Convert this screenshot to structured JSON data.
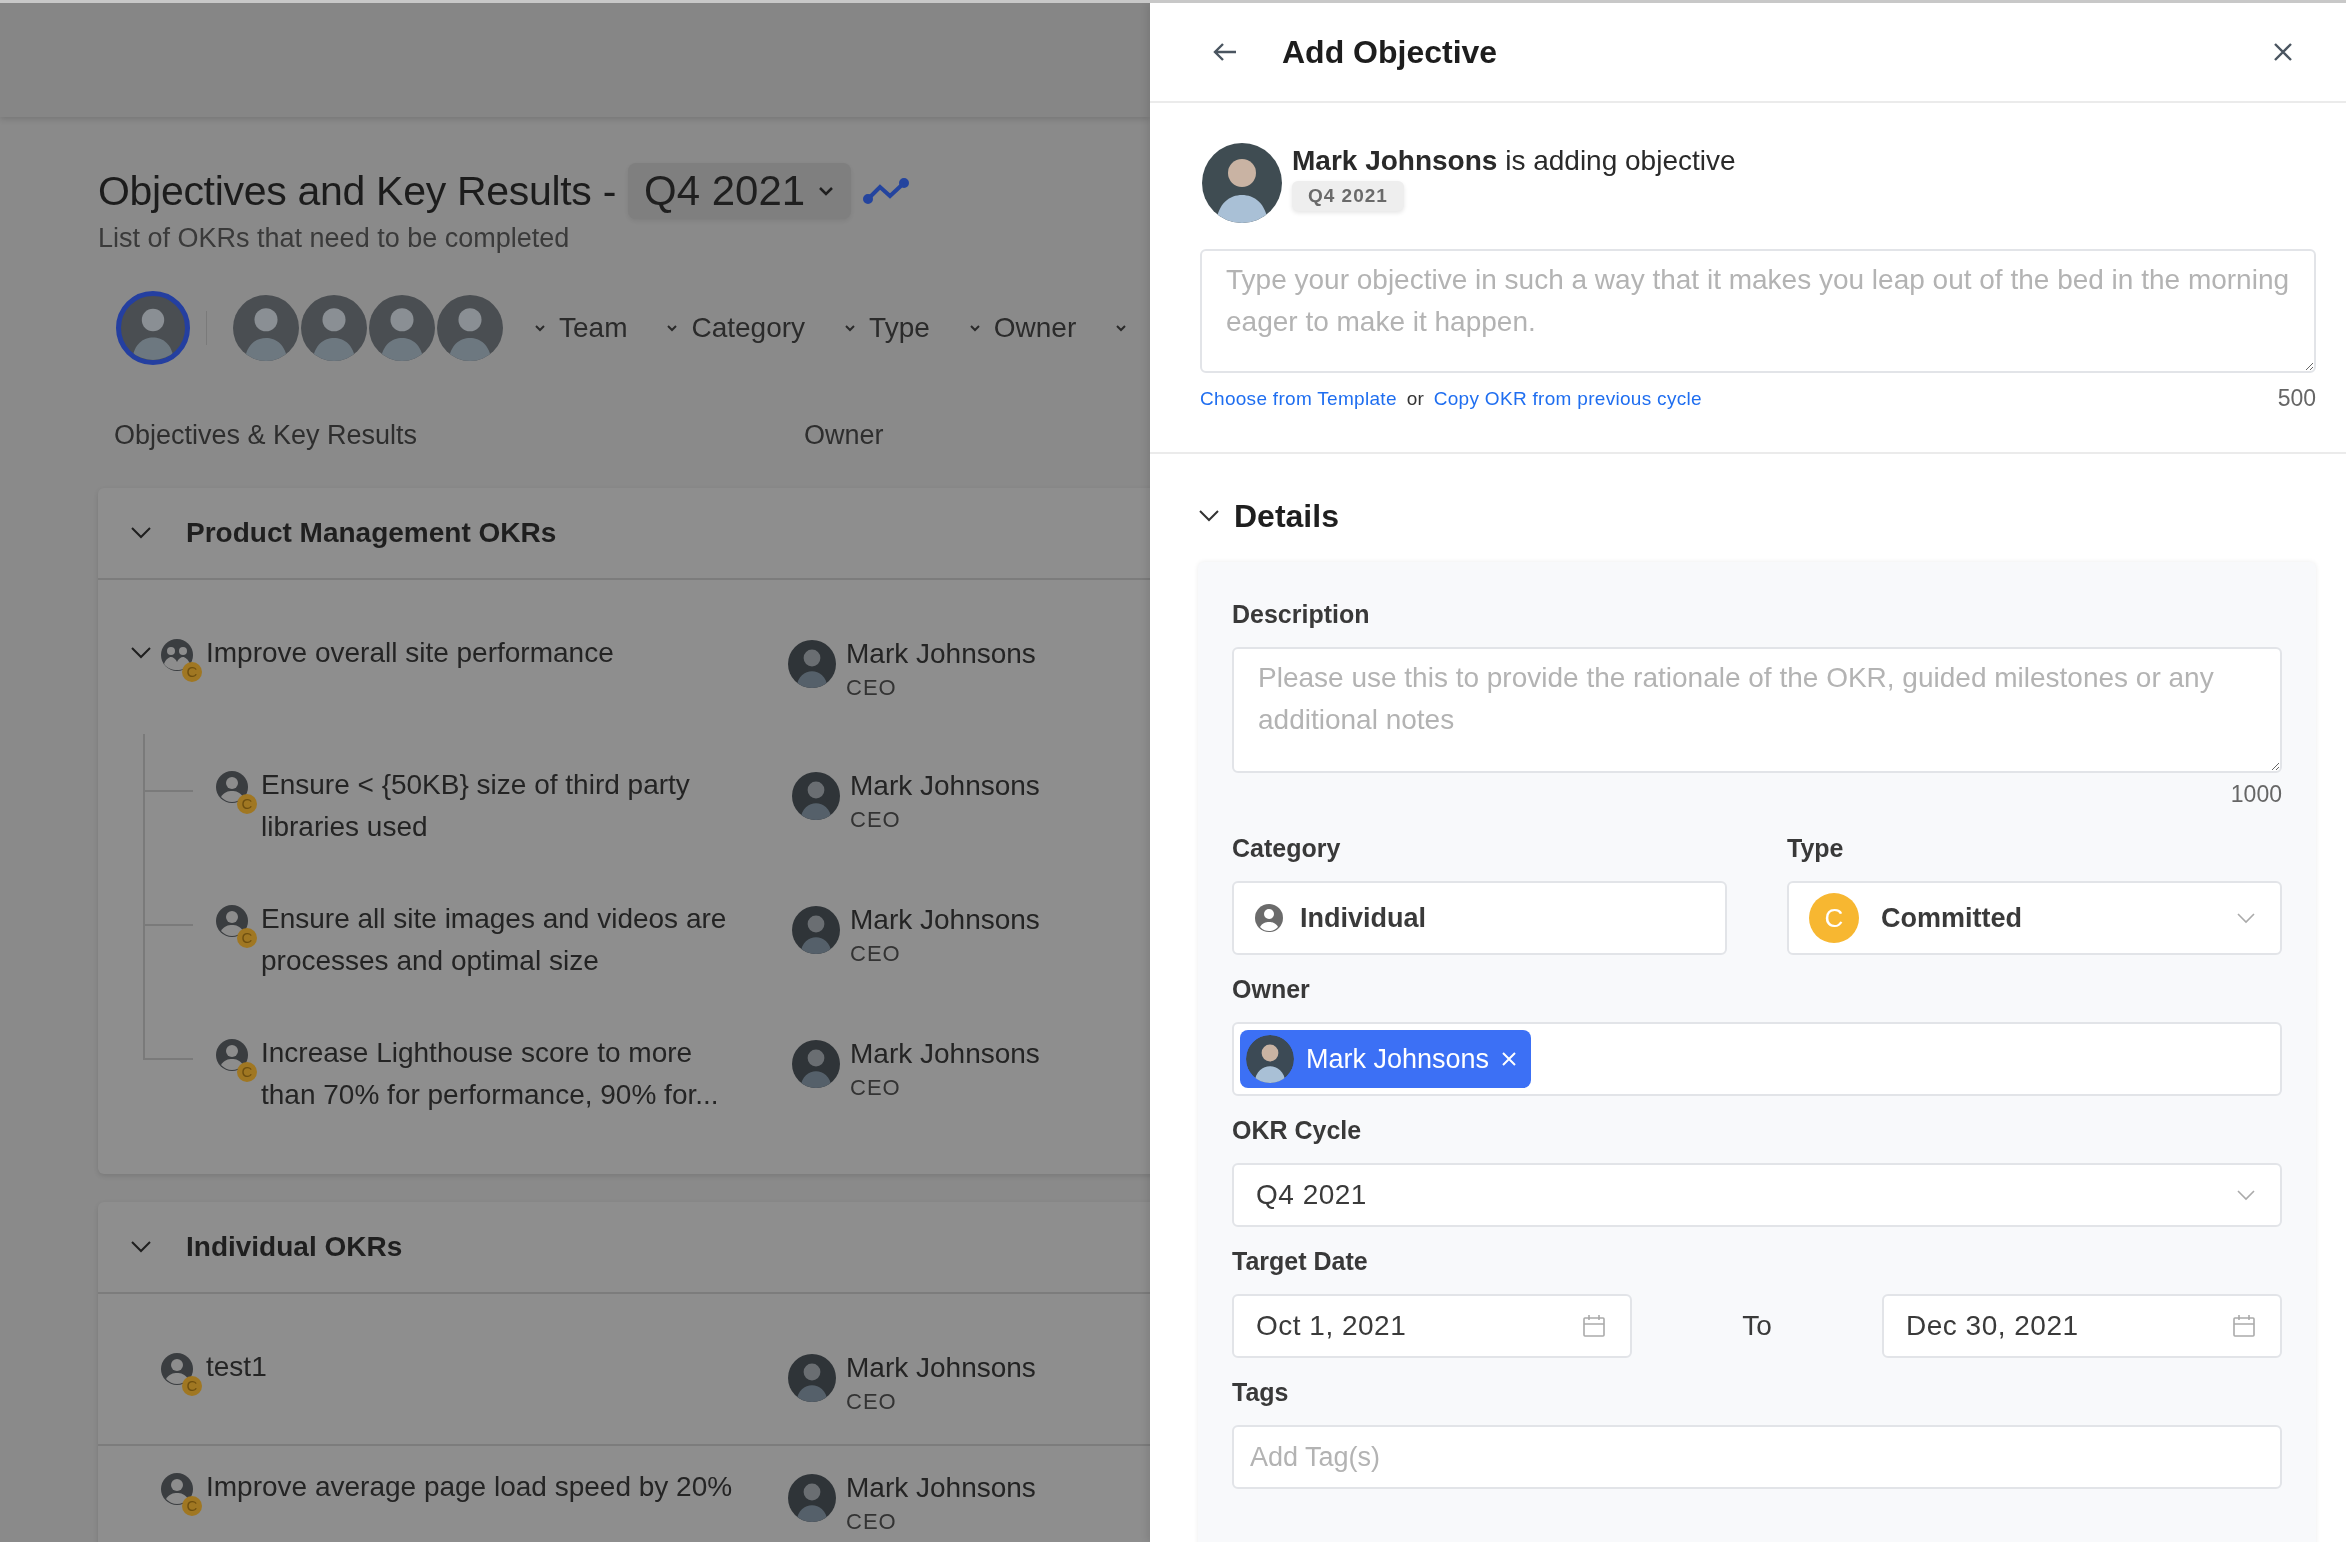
{
  "page": {
    "title": "Objectives and Key Results -",
    "cycle": "Q4 2021",
    "subtitle": "List of OKRs that need to be completed"
  },
  "avatars": [
    {
      "selected": true
    },
    {
      "selected": false
    },
    {
      "selected": false
    },
    {
      "selected": false
    },
    {
      "selected": false
    }
  ],
  "filters": [
    "Team",
    "Category",
    "Type",
    "Owner"
  ],
  "columns": [
    "Objectives & Key Results",
    "Owner"
  ],
  "groups": [
    {
      "title": "Product Management OKRs",
      "expanded": true,
      "objectives": [
        {
          "kind": "team",
          "badge": "C",
          "text": "Improve overall site performance",
          "owner": "Mark Johnsons",
          "role": "CEO",
          "expanded": true,
          "children": [
            {
              "kind": "individual",
              "badge": "C",
              "text": "Ensure < {50KB} size of third party libraries used",
              "owner": "Mark Johnsons",
              "role": "CEO"
            },
            {
              "kind": "individual",
              "badge": "C",
              "text": "Ensure all site images and videos are processes and optimal size",
              "owner": "Mark Johnsons",
              "role": "CEO"
            },
            {
              "kind": "individual",
              "badge": "C",
              "text": "Increase Lighthouse score to more than 70% for performance, 90% for...",
              "owner": "Mark Johnsons",
              "role": "CEO"
            }
          ]
        }
      ]
    },
    {
      "title": "Individual OKRs",
      "expanded": true,
      "objectives": [
        {
          "kind": "individual",
          "badge": "C",
          "text": "test1",
          "owner": "Mark Johnsons",
          "role": "CEO"
        },
        {
          "kind": "individual",
          "badge": "C",
          "text": "Improve average page load speed by 20%",
          "owner": "Mark Johnsons",
          "role": "CEO"
        }
      ]
    }
  ],
  "panel": {
    "title": "Add Objective",
    "creator": {
      "name": "Mark Johnsons",
      "action": "is adding objective",
      "cycle": "Q4 2021"
    },
    "objective_placeholder": "Type your objective in such a way that it makes you leap out of the bed in the morning eager to make it happen.",
    "template_link": "Choose from Template",
    "or": "or",
    "copy_link": "Copy OKR from previous cycle",
    "objective_limit": "500",
    "details": {
      "title": "Details",
      "expanded": true,
      "description": {
        "label": "Description",
        "placeholder": "Please use this to provide the rationale of the OKR, guided milestones or any additional notes",
        "limit": "1000"
      },
      "category": {
        "label": "Category",
        "value": "Individual"
      },
      "type": {
        "label": "Type",
        "badge": "C",
        "value": "Committed"
      },
      "owner": {
        "label": "Owner",
        "chips": [
          "Mark Johnsons"
        ]
      },
      "cycle": {
        "label": "OKR Cycle",
        "value": "Q4 2021"
      },
      "target_date": {
        "label": "Target Date",
        "from": "Oct 1, 2021",
        "separator": "To",
        "to": "Dec 30, 2021"
      },
      "tags": {
        "label": "Tags",
        "placeholder": "Add Tag(s)"
      }
    }
  }
}
